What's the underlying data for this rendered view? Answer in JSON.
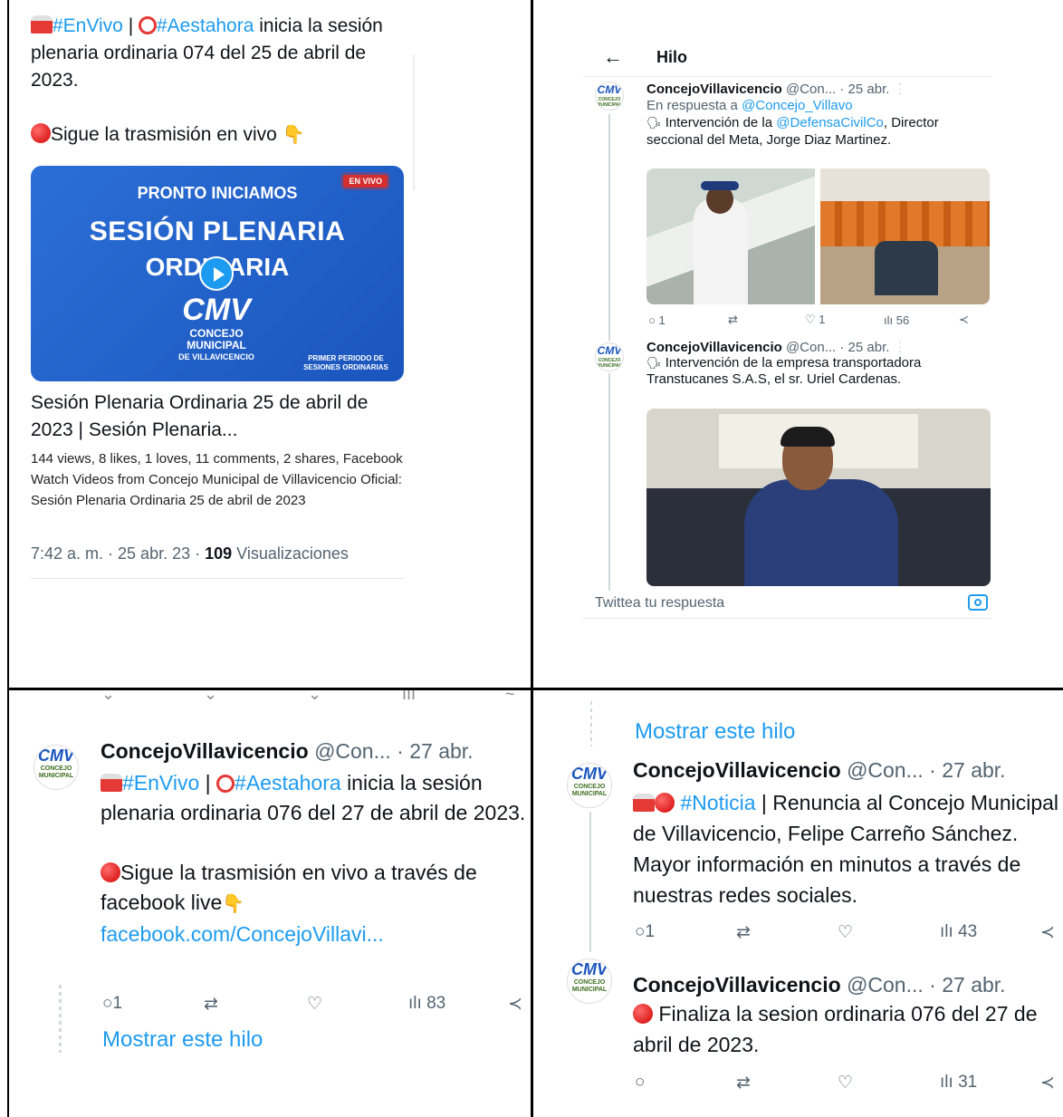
{
  "panel1": {
    "hashtag_envivo": "#EnVivo",
    "separator": "|",
    "hashtag_aestahora": "#Aestahora",
    "text_rest": "inicia la sesión plenaria ordinaria 074 del 25 de abril de 2023.",
    "follow_text": "Sigue la trasmisión en vivo",
    "video": {
      "line1": "PRONTO INICIAMOS",
      "line2": "SESIÓN PLENARIA",
      "line3": "ORDINARIA",
      "live_badge": "EN VIVO",
      "logo_cmv": "CMV",
      "logo_line1": "CONCEJO",
      "logo_line2": "MUNICIPAL",
      "logo_line3": "DE VILLAVICENCIO",
      "period": "PRIMER PERIODO DE SESIONES ORDINARIAS"
    },
    "card_title": "Sesión Plenaria Ordinaria 25 de abril de 2023 | Sesión Plenaria...",
    "card_desc": "144 views, 8 likes, 1 loves, 11 comments, 2 shares, Facebook Watch Videos from Concejo Municipal de Villavicencio Oficial: Sesión Plenaria Ordinaria 25 de abril de 2023",
    "meta_time": "7:42 a. m. · 25 abr. 23 · ",
    "meta_views": "109",
    "meta_views_label": " Visualizaciones"
  },
  "panel2": {
    "back_icon": "arrow-left-icon",
    "header": "Hilo",
    "tweet1": {
      "name": "ConcejoVillavicencio",
      "handle": "@Con...",
      "date": "· 25 abr.",
      "reply_prefix": "En respuesta a",
      "reply_handle": "@Concejo_Villavo",
      "body_pre": "Intervención de la",
      "body_link": "@DefensaCivilCo",
      "body_post": ", Director seccional del Meta, Jorge Diaz Martinez.",
      "replies": "1",
      "likes": "1",
      "views": "56"
    },
    "tweet2": {
      "name": "ConcejoVillavicencio",
      "handle": "@Con...",
      "date": "· 25 abr.",
      "body": "Intervención de la empresa transportadora Transtucanes S.A.S, el sr. Uriel Cardenas."
    },
    "reply_placeholder": "Twittea tu respuesta"
  },
  "panel3": {
    "name": "ConcejoVillavicencio",
    "handle": "@Con...",
    "date": "· 27 abr.",
    "hashtag_envivo": "#EnVivo",
    "separator": "|",
    "hashtag_aestahora": "#Aestahora",
    "text_rest": "inicia la sesión plenaria ordinaria 076 del 27 de abril de 2023.",
    "follow_text": "Sigue la trasmisión en vivo a través de facebook live",
    "link": "facebook.com/ConcejoVillavi...",
    "replies": "1",
    "views": "83",
    "show_thread": "Mostrar este hilo"
  },
  "panel4": {
    "show_thread": "Mostrar este hilo",
    "tweet1": {
      "name": "ConcejoVillavicencio",
      "handle": "@Con...",
      "date": "· 27 abr.",
      "hashtag": "#Noticia",
      "body": "| Renuncia al Concejo Municipal de Villavicencio, Felipe Carreño Sánchez. Mayor información en minutos a través de nuestras redes sociales.",
      "replies": "1",
      "views": "43"
    },
    "tweet2": {
      "name": "ConcejoVillavicencio",
      "handle": "@Con...",
      "date": "· 27 abr.",
      "body": "Finaliza la sesion ordinaria 076 del 27 de abril de 2023.",
      "views": "31"
    }
  },
  "colors": {
    "link": "#1d9bf0",
    "muted": "#536471",
    "video_bg": "#1a55bd"
  }
}
